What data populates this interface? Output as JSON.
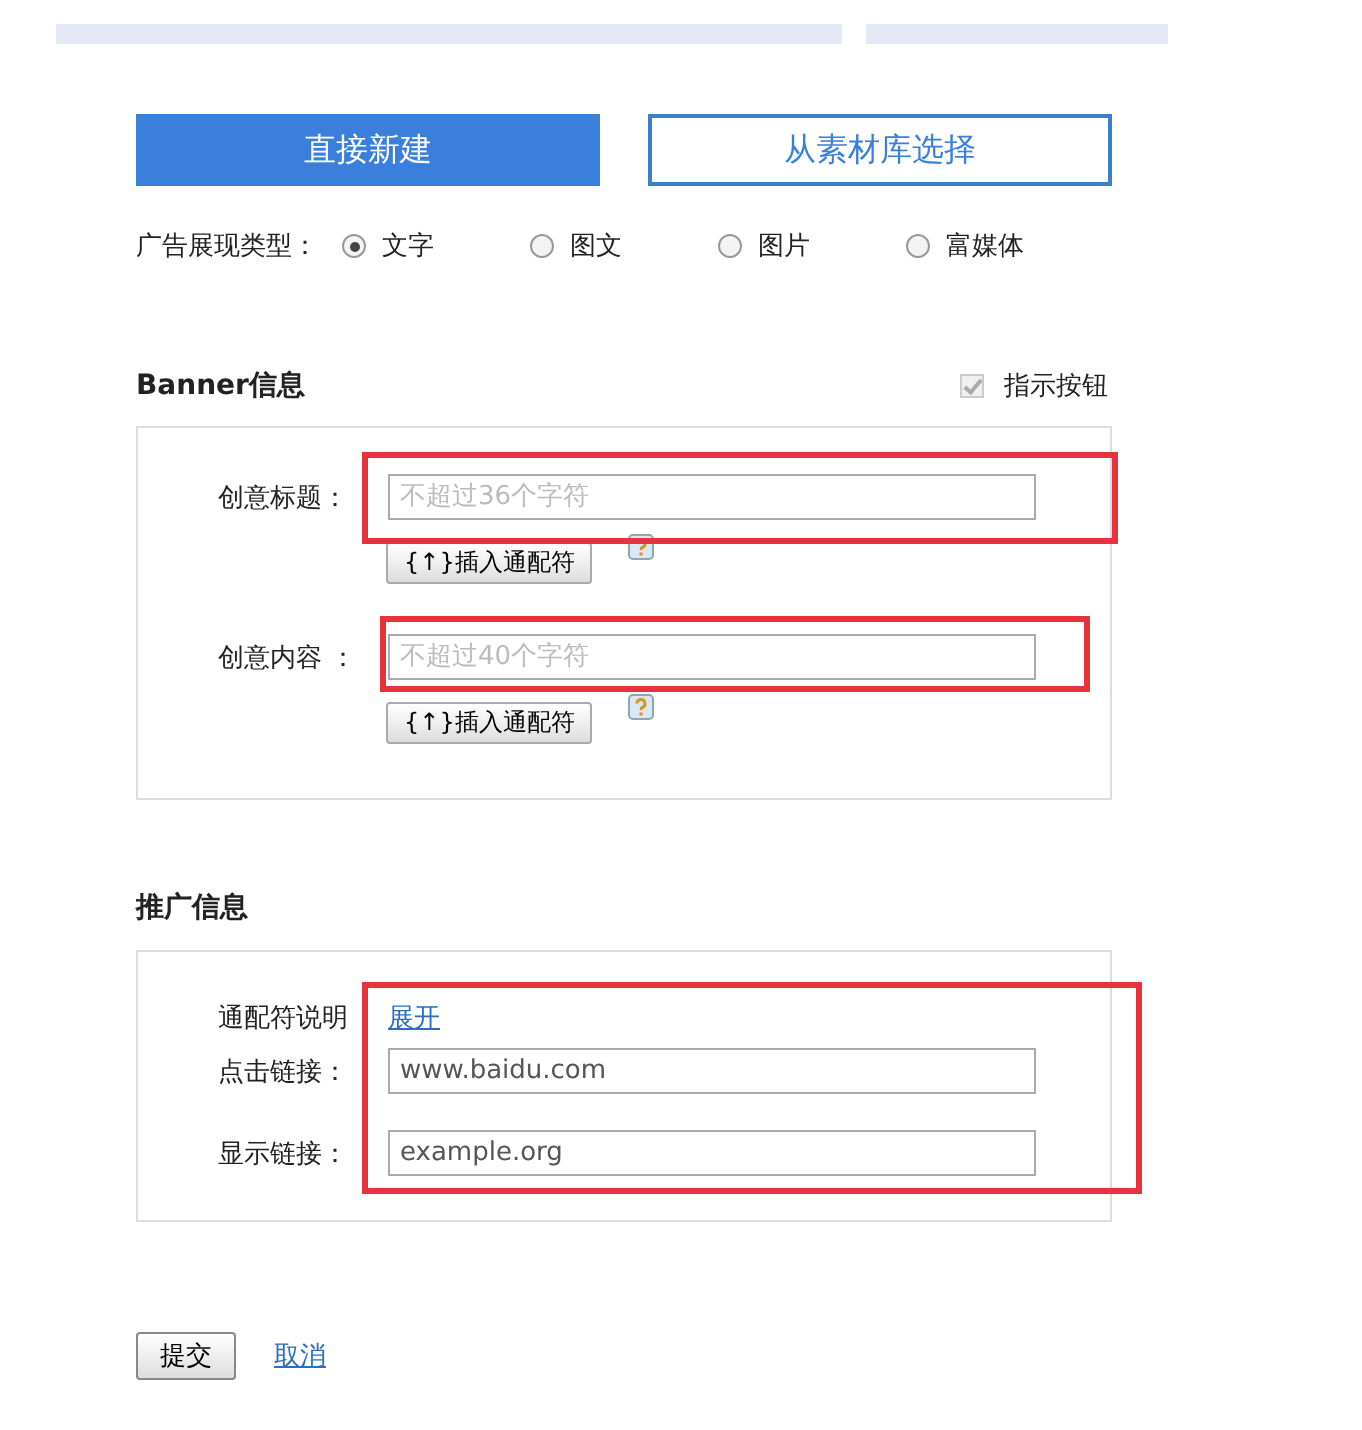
{
  "mode_buttons": [
    {
      "label": "直接新建",
      "selected": true
    },
    {
      "label": "从素材库选择",
      "selected": false
    }
  ],
  "ad_type": {
    "label": "广告展现类型：",
    "options": [
      {
        "label": "文字",
        "selected": true
      },
      {
        "label": "图文",
        "selected": false
      },
      {
        "label": "图片",
        "selected": false
      },
      {
        "label": "富媒体",
        "selected": false
      }
    ]
  },
  "banner": {
    "title": "Banner信息",
    "indicator": {
      "label": "指示按钮",
      "checked": true,
      "disabled": true
    },
    "fields": [
      {
        "label": "创意标题：",
        "placeholder": "不超过36个字符",
        "highlighted": true,
        "insert_button": "{↑}插入通配符"
      },
      {
        "label": "创意内容 ：",
        "placeholder": "不超过40个字符",
        "highlighted": true,
        "insert_button": "{↑}插入通配符"
      }
    ]
  },
  "promotion": {
    "title": "推广信息",
    "highlighted": true,
    "wildcard": {
      "label": "通配符说明",
      "link": "展开"
    },
    "fields": [
      {
        "label": "点击链接：",
        "value": "www.baidu.com"
      },
      {
        "label": "显示链接：",
        "value": "example.org"
      }
    ]
  },
  "actions": {
    "submit": "提交",
    "cancel": "取消"
  }
}
